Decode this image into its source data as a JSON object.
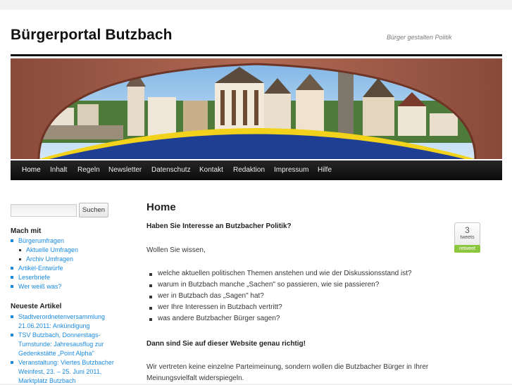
{
  "site": {
    "title": "Bürgerportal Butzbach",
    "tagline": "Bürger gestalten Politik"
  },
  "nav": {
    "items": [
      {
        "label": "Home",
        "active": true
      },
      {
        "label": "Inhalt"
      },
      {
        "label": "Regeln"
      },
      {
        "label": "Newsletter"
      },
      {
        "label": "Datenschutz"
      },
      {
        "label": "Kontakt"
      },
      {
        "label": "Redaktion"
      },
      {
        "label": "Impressum"
      },
      {
        "label": "Hilfe"
      }
    ]
  },
  "sidebar": {
    "search": {
      "button_label": "Suchen",
      "value": ""
    },
    "mach_mit": {
      "title": "Mach mit",
      "items": [
        {
          "label": "Bürgerumfragen"
        },
        {
          "label": "Aktuelle Umfragen"
        },
        {
          "label": "Archiv Umfragen"
        },
        {
          "label": "Artikel-Entwürfe"
        },
        {
          "label": "Leserbriefe"
        },
        {
          "label": "Wer weiß was?"
        }
      ]
    },
    "neueste": {
      "title": "Neueste Artikel",
      "items": [
        {
          "line1": "Stadtverordnetenversammlung",
          "line2": "21.06.2011: Ankündigung"
        },
        {
          "line1": "TSV Butzbach, Donnerstags-",
          "line2": "Turnstunde: Jahresausflug zur",
          "line3": "Gedenkstätte „Point Alpha\""
        },
        {
          "line1": "Veranstaltung: Viertes Butzbacher",
          "line2": "Weinfest, 23. – 25. Juni 2011,",
          "line3": "Marktplatz Butzbach"
        }
      ]
    }
  },
  "main": {
    "title": "Home",
    "intro_question": "Haben Sie Interesse an Butzbacher Politik?",
    "wollen": "Wollen Sie wissen,",
    "list": [
      "welche aktuellen politischen Themen anstehen und wie der Diskussionsstand ist?",
      "warum in Butzbach manche „Sachen\" so passieren, wie sie passieren?",
      "wer in Butzbach das „Sagen\" hat?",
      "wer Ihre Interessen in Butzbach vertritt?",
      "was andere Butzbacher Bürger sagen?"
    ],
    "dann": "Dann sind Sie auf dieser Website genau richtig!",
    "para_line1": "Wir vertreten keine einzelne Parteimeinung, sondern wollen die Butzbacher Bürger in Ihrer",
    "para_line2": "Meinungsvielfalt widerspiegeln."
  },
  "tweet": {
    "count": "3",
    "unit": "tweets",
    "button": "retweet"
  },
  "colors": {
    "link": "#1b8be0",
    "retweet": "#8cc63f",
    "nav_bg": "#1a1a1a"
  },
  "icons": [
    "search-icon",
    "tweetmeme-icon"
  ]
}
